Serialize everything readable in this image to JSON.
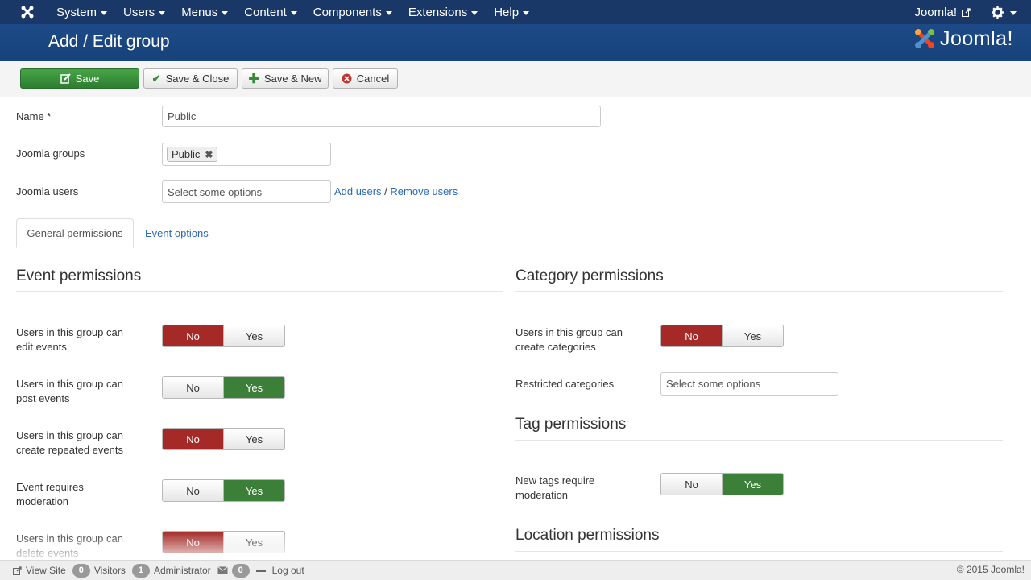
{
  "topnav": {
    "menu": [
      "System",
      "Users",
      "Menus",
      "Content",
      "Components",
      "Extensions",
      "Help"
    ],
    "site_link": "Joomla!"
  },
  "header": {
    "title": "Add / Edit group",
    "brand": "Joomla!"
  },
  "toolbar": {
    "save": "Save",
    "save_close": "Save & Close",
    "save_new": "Save & New",
    "cancel": "Cancel"
  },
  "form": {
    "name_label": "Name *",
    "name_value": "Public",
    "groups_label": "Joomla groups",
    "groups_chip": "Public",
    "users_label": "Joomla users",
    "users_placeholder": "Select some options",
    "add_users": "Add users",
    "separator": "/",
    "remove_users": "Remove users"
  },
  "tabs": [
    "General permissions",
    "Event options"
  ],
  "event_permissions": {
    "title": "Event permissions",
    "rows": [
      {
        "line1": "Users in this group can",
        "line2": "edit events",
        "value": "No"
      },
      {
        "line1": "Users in this group can",
        "line2": "post events",
        "value": "Yes"
      },
      {
        "line1": "Users in this group can",
        "line2": "create repeated events",
        "value": "No"
      },
      {
        "line1": "Event requires",
        "line2": "moderation",
        "value": "Yes"
      },
      {
        "line1": "Users in this group can",
        "line2": "delete events",
        "value": "No"
      }
    ]
  },
  "category_permissions": {
    "title": "Category permissions",
    "row1_line1": "Users in this group can",
    "row1_line2": "create categories",
    "row1_value": "No",
    "restricted_label": "Restricted categories",
    "restricted_placeholder": "Select some options"
  },
  "tag_permissions": {
    "title": "Tag permissions",
    "line1": "New tags require",
    "line2": "moderation",
    "value": "Yes"
  },
  "location_permissions": {
    "title": "Location permissions"
  },
  "toggle_labels": {
    "no": "No",
    "yes": "Yes"
  },
  "statusbar": {
    "view_site": "View Site",
    "visitors_count": "0",
    "visitors": "Visitors",
    "admin_count": "1",
    "admin": "Administrator",
    "messages_count": "0",
    "logout": "Log out",
    "copyright": "© 2015 Joomla!"
  },
  "colors": {
    "nav_bg": "#1a3867",
    "header_bg": "#1d4a87",
    "save_green": "#3b8e3b",
    "no_active": "#a52a27",
    "yes_active": "#3b7f38",
    "link": "#2a69b8"
  }
}
